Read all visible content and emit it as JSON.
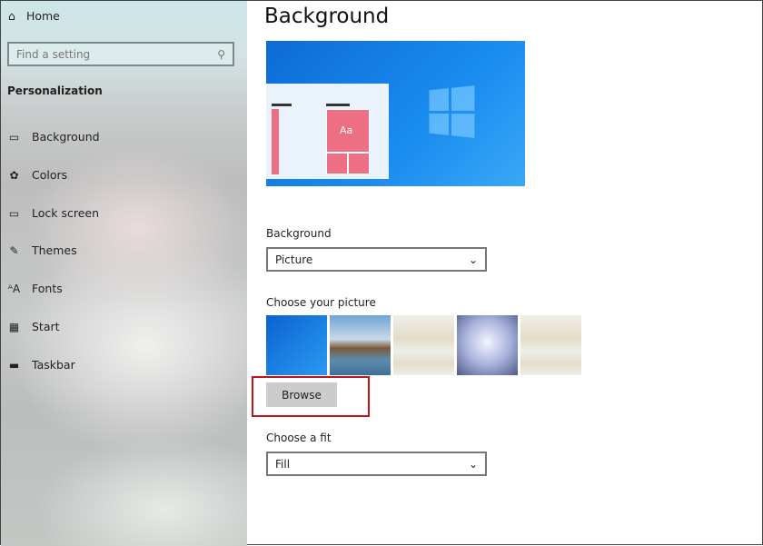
{
  "sidebar": {
    "home": "Home",
    "search_placeholder": "Find a setting",
    "section": "Personalization",
    "items": [
      {
        "label": "Background",
        "icon": "picture-icon"
      },
      {
        "label": "Colors",
        "icon": "palette-icon"
      },
      {
        "label": "Lock screen",
        "icon": "lock-screen-icon"
      },
      {
        "label": "Themes",
        "icon": "themes-icon"
      },
      {
        "label": "Fonts",
        "icon": "fonts-icon"
      },
      {
        "label": "Start",
        "icon": "start-icon"
      },
      {
        "label": "Taskbar",
        "icon": "taskbar-icon"
      }
    ]
  },
  "main": {
    "title": "Background",
    "preview_tile_text": "Aa",
    "background_label": "Background",
    "background_value": "Picture",
    "choose_picture_label": "Choose your picture",
    "browse": "Browse",
    "fit_label": "Choose a fit",
    "fit_value": "Fill"
  },
  "colors": {
    "highlight": "#c0141c",
    "accent": "#0d6bd6",
    "tile": "#ec6f84"
  }
}
